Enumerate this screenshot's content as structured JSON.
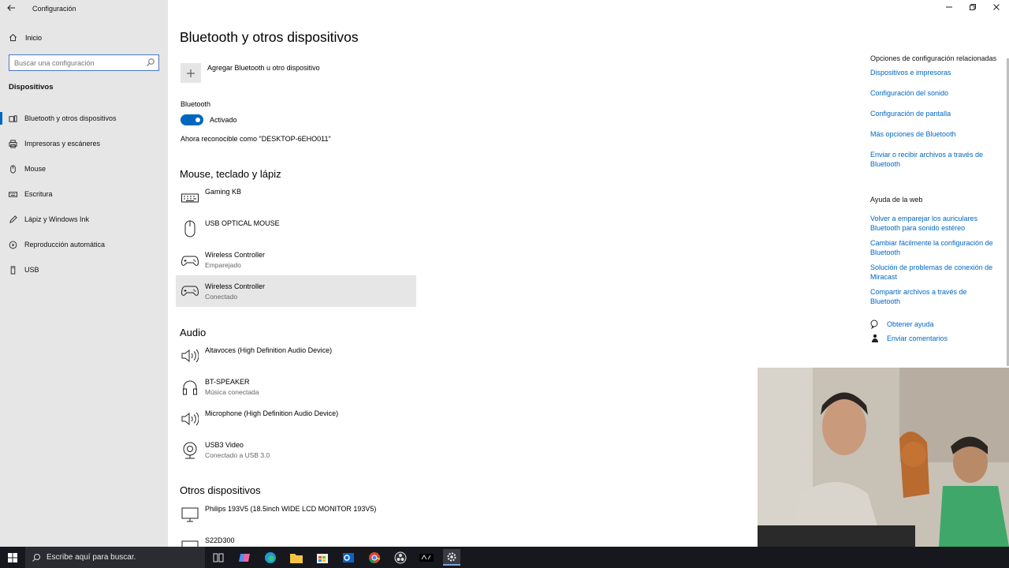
{
  "window": {
    "title": "Configuración",
    "back_icon": "back-arrow-icon",
    "controls": [
      "minimize",
      "restore",
      "close"
    ]
  },
  "sidebar": {
    "home_label": "Inicio",
    "search_placeholder": "Buscar una configuración",
    "section_title": "Dispositivos",
    "items": [
      {
        "label": "Bluetooth y otros dispositivos",
        "icon": "bluetooth-icon",
        "active": true
      },
      {
        "label": "Impresoras y escáneres",
        "icon": "printer-icon",
        "active": false
      },
      {
        "label": "Mouse",
        "icon": "mouse-icon",
        "active": false
      },
      {
        "label": "Escritura",
        "icon": "keyboard-icon",
        "active": false
      },
      {
        "label": "Lápiz y Windows Ink",
        "icon": "pen-icon",
        "active": false
      },
      {
        "label": "Reproducción automática",
        "icon": "autoplay-icon",
        "active": false
      },
      {
        "label": "USB",
        "icon": "usb-icon",
        "active": false
      }
    ]
  },
  "main": {
    "page_title": "Bluetooth y otros dispositivos",
    "add_device_label": "Agregar Bluetooth u otro dispositivo",
    "bluetooth_label": "Bluetooth",
    "bluetooth_toggle_state": "Activado",
    "discoverable_text": "Ahora reconocible como \"DESKTOP-6EHO011\"",
    "groups": [
      {
        "title": "Mouse, teclado y lápiz",
        "devices": [
          {
            "name": "Gaming KB",
            "status": "",
            "icon": "keyboard-icon"
          },
          {
            "name": "USB OPTICAL MOUSE",
            "status": "",
            "icon": "mouse-icon"
          },
          {
            "name": "Wireless Controller",
            "status": "Emparejado",
            "icon": "gamepad-icon"
          },
          {
            "name": "Wireless Controller",
            "status": "Conectado",
            "icon": "gamepad-icon"
          }
        ]
      },
      {
        "title": "Audio",
        "devices": [
          {
            "name": "Altavoces (High Definition Audio Device)",
            "status": "",
            "icon": "speaker-icon"
          },
          {
            "name": "BT-SPEAKER",
            "status": "Música conectada",
            "icon": "headphones-icon"
          },
          {
            "name": "Microphone (High Definition Audio Device)",
            "status": "",
            "icon": "speaker-icon"
          },
          {
            "name": "USB3 Video",
            "status": "Conectado a USB 3.0",
            "icon": "webcam-icon"
          }
        ]
      },
      {
        "title": "Otros dispositivos",
        "devices": [
          {
            "name": "Philips 193V5 (18.5inch WIDE LCD MONITOR 193V5)",
            "status": "",
            "icon": "monitor-icon"
          },
          {
            "name": "S22D300",
            "status": "",
            "icon": "monitor-icon"
          }
        ]
      }
    ]
  },
  "related": {
    "heading": "Opciones de configuración relacionadas",
    "links": [
      "Dispositivos e impresoras",
      "Configuración del sonido",
      "Configuración de pantalla",
      "Más opciones de Bluetooth",
      "Enviar o recibir archivos a través de Bluetooth"
    ],
    "help_heading": "Ayuda de la web",
    "help_links": [
      "Volver a emparejar los auriculares Bluetooth para sonido estéreo",
      "Cambiar fácilmente la configuración de Bluetooth",
      "Solución de problemas de conexión de Miracast",
      "Compartir archivos a través de Bluetooth"
    ],
    "get_help": "Obtener ayuda",
    "feedback": "Enviar comentarios"
  },
  "taskbar": {
    "search_placeholder": "Escribe aquí para buscar.",
    "apps": [
      "task-view-icon",
      "copilot-icon",
      "edge-icon",
      "file-explorer-icon",
      "store-icon",
      "outlook-icon",
      "chrome-icon",
      "obs-icon",
      "acer-icon",
      "settings-icon"
    ]
  },
  "colors": {
    "accent": "#0067c0",
    "sidebar_bg": "#e6e6e6",
    "hover_bg": "#e6e6e6",
    "taskbar_bg": "#16181d"
  }
}
